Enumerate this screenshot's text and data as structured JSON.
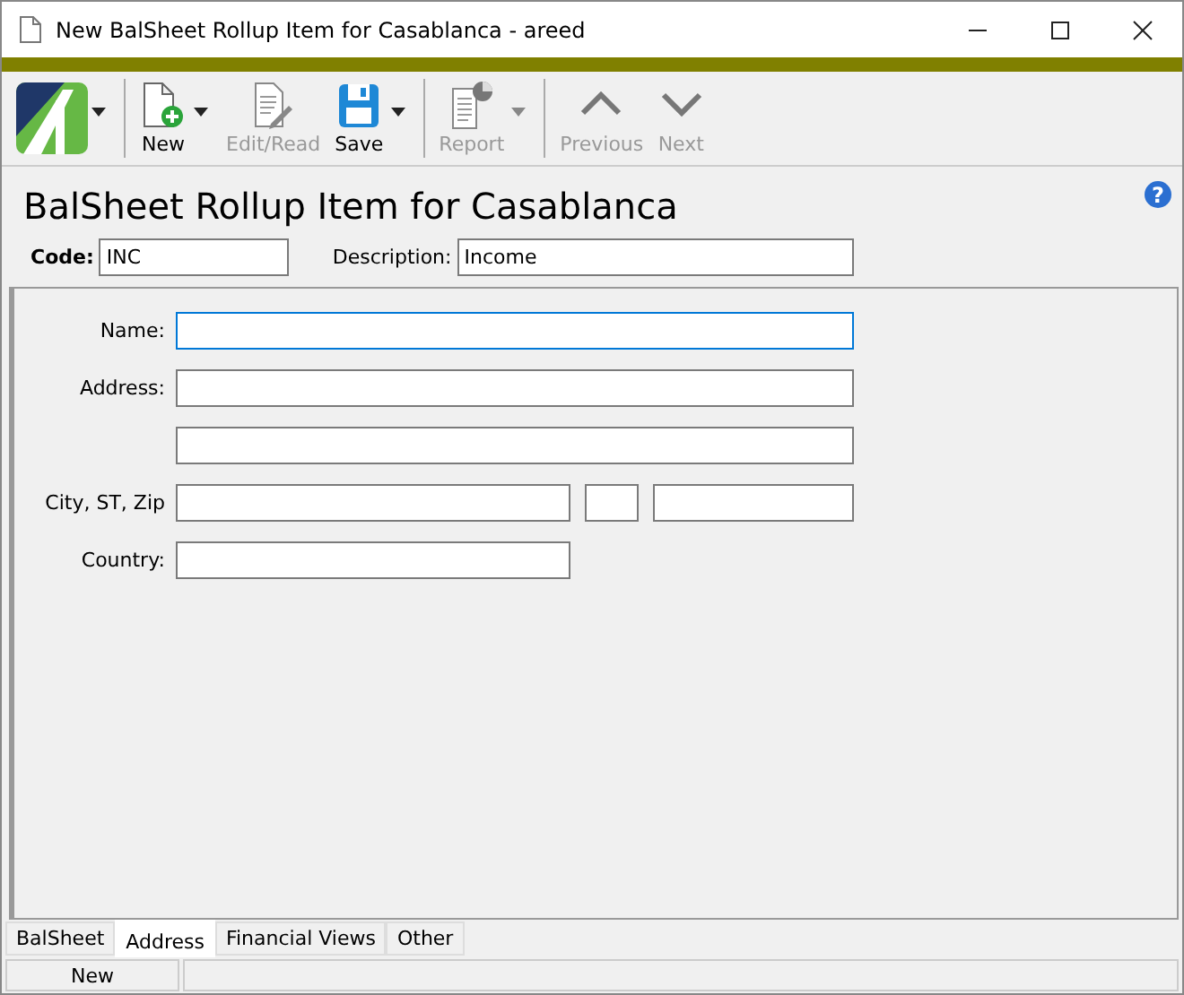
{
  "window": {
    "title": "New BalSheet Rollup Item for Casablanca - areed"
  },
  "toolbar": [
    [
      {
        "kind": "logo",
        "dropdown": true
      }
    ],
    [
      {
        "kind": "new",
        "label": "New",
        "disabled": false,
        "dropdown": true
      },
      {
        "kind": "edit",
        "label": "Edit/Read",
        "disabled": true,
        "dropdown": false
      },
      {
        "kind": "save",
        "label": "Save",
        "disabled": false,
        "dropdown": true
      }
    ],
    [
      {
        "kind": "report",
        "label": "Report",
        "disabled": true,
        "dropdown": true
      }
    ],
    [
      {
        "kind": "previous",
        "label": "Previous",
        "disabled": true,
        "dropdown": false
      },
      {
        "kind": "next",
        "label": "Next",
        "disabled": true,
        "dropdown": false
      }
    ]
  ],
  "heading": "BalSheet Rollup Item for Casablanca",
  "help": "?",
  "code": {
    "label": "Code:",
    "value": "INC"
  },
  "description": {
    "label": "Description:",
    "value": "Income"
  },
  "address_form": [
    {
      "label": "Name:",
      "fields": [
        {
          "kind": "full",
          "focused": true
        }
      ]
    },
    {
      "label": "Address:",
      "fields": [
        {
          "kind": "full",
          "focused": false
        }
      ]
    },
    {
      "fields": [
        {
          "kind": "full",
          "focused": false
        }
      ]
    },
    {
      "label": "City, ST, Zip",
      "fields": [
        {
          "kind": "city",
          "focused": false
        },
        {
          "kind": "state",
          "focused": false
        },
        {
          "kind": "zip",
          "focused": false
        }
      ]
    },
    {
      "label": "Country:",
      "fields": [
        {
          "kind": "city",
          "focused": false
        }
      ]
    }
  ],
  "tabs": [
    {
      "label": "BalSheet",
      "selected": false
    },
    {
      "label": "Address",
      "selected": true
    },
    {
      "label": "Financial Views",
      "selected": false
    },
    {
      "label": "Other",
      "selected": false
    }
  ],
  "status_bar": {
    "text": "New"
  }
}
